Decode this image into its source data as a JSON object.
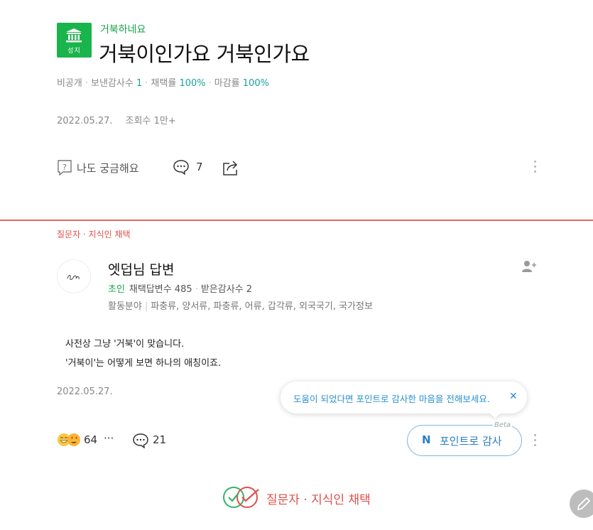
{
  "question": {
    "badge_text": "성지",
    "category": "거북하네요",
    "title": "거북이인가요 거북인가요",
    "meta": {
      "visibility": "비공개",
      "thanks_sent_label": "보낸감사수",
      "thanks_sent_value": "1",
      "adopt_rate_label": "채택률",
      "adopt_rate_value": "100%",
      "close_rate_label": "마감률",
      "close_rate_value": "100%"
    },
    "date": "2022.05.27.",
    "views": "조회수 1만+",
    "actions": {
      "curious_label": "나도 궁금해요",
      "comment_count": "7"
    }
  },
  "answer": {
    "selection_label": "질문자 · 지식인 채택",
    "author_name": "엣덥님 답변",
    "grade": "초인",
    "adopted_answers_label": "채택답변수",
    "adopted_answers_value": "485",
    "received_thanks_label": "받은감사수",
    "received_thanks_value": "2",
    "fields_label": "활동분야",
    "fields": "파충류, 양서류, 파충류, 어류, 갑각류, 외국국기, 국가정보",
    "body_lines": [
      "사전상 그냥 '거북'이 맞습니다.",
      "'거북이'는 어떻게 보면 하나의 애칭이죠."
    ],
    "date": "2022.05.27.",
    "tooltip": "도움이 되었다면 포인트로 감사한 마음을 전해보세요.",
    "reaction_count": "64",
    "more_label": "···",
    "comment_count": "21",
    "point_button": {
      "label": "포인트로 감사",
      "beta": "Beta",
      "symbol": "N"
    },
    "selected_mark_label": "질문자 · 지식인 채택"
  },
  "colors": {
    "brand_green": "#19b44b",
    "accent_red": "#e0504a",
    "accent_blue": "#2a7fc1",
    "teal": "#19a0a0"
  },
  "icons": [
    "temple-icon",
    "question-icon",
    "comment-icon",
    "share-icon",
    "kebab-icon",
    "add-friend-icon",
    "close-icon",
    "emoji-icon",
    "double-check-icon",
    "pencil-icon"
  ]
}
